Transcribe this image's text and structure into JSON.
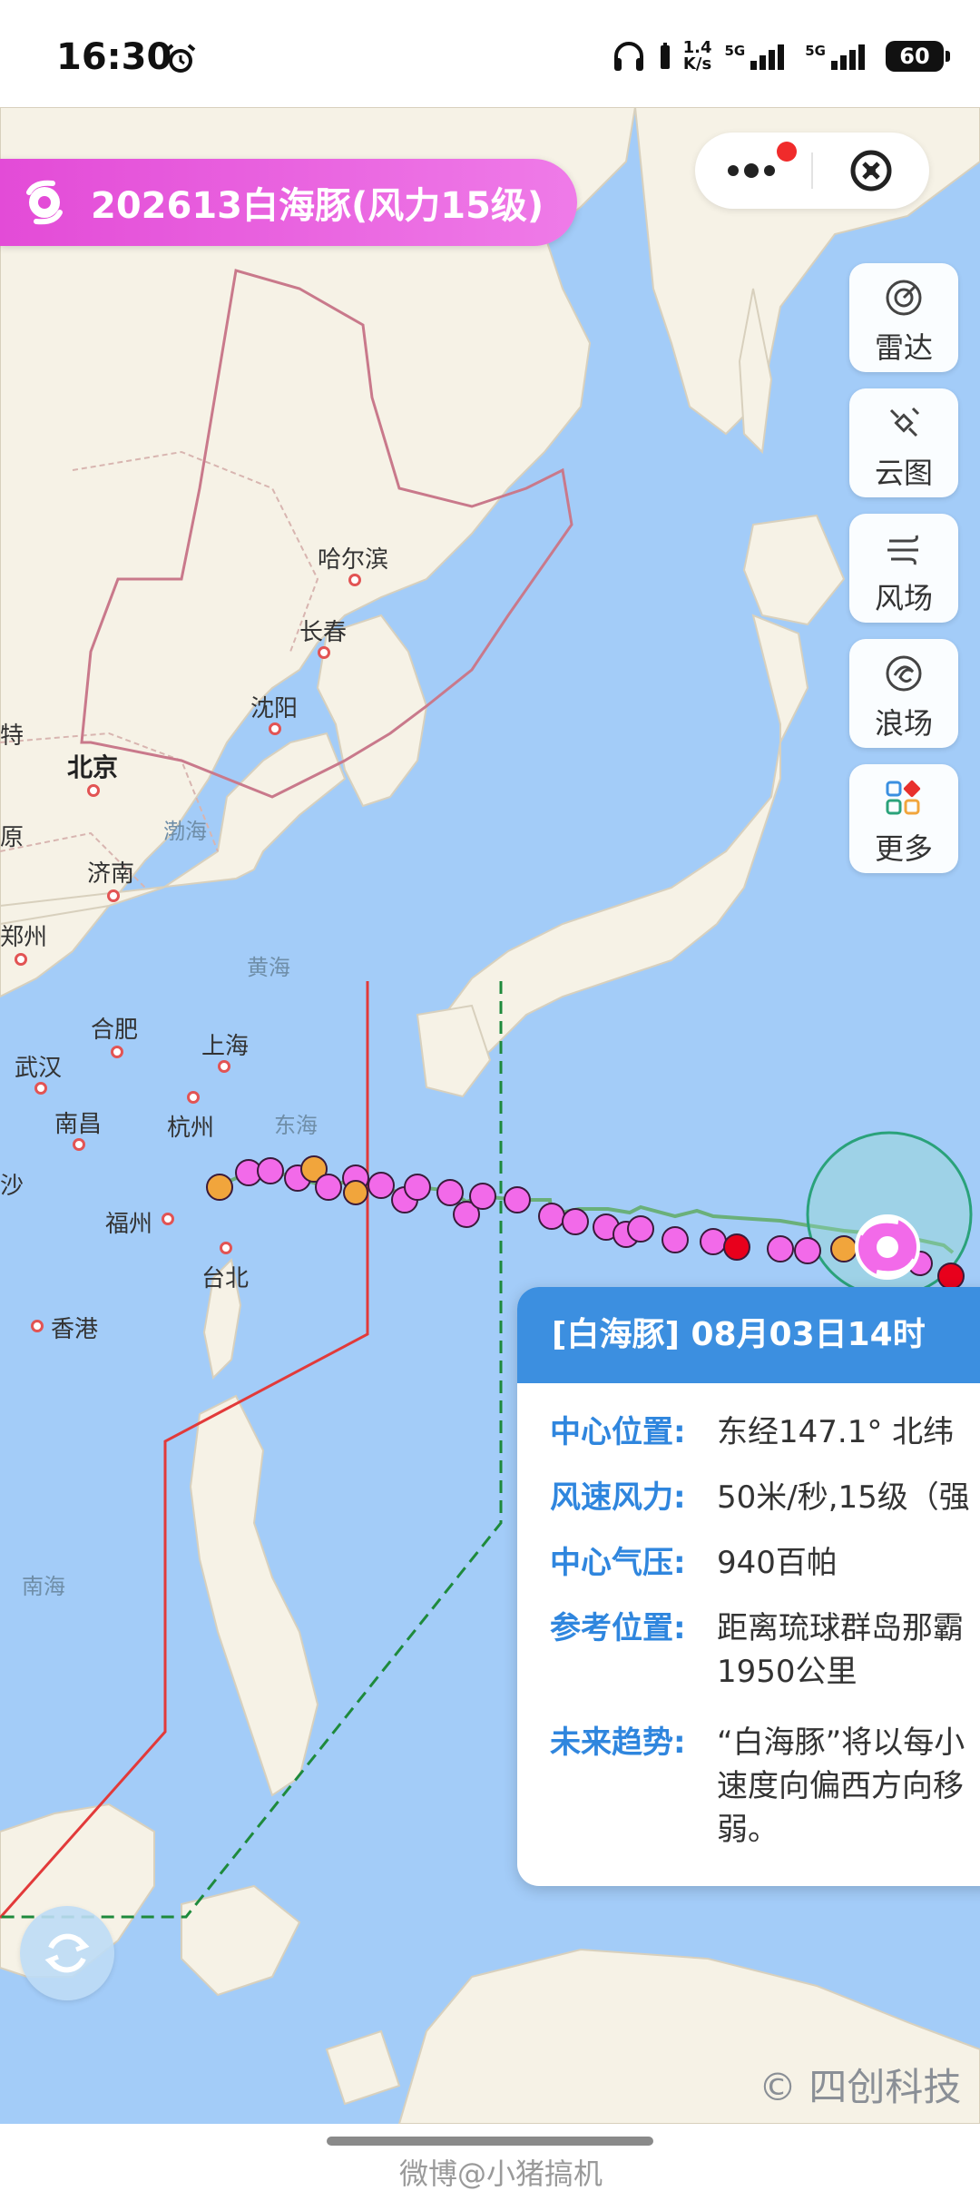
{
  "status_bar": {
    "time": "16:30",
    "net_speed_top": "1.4",
    "net_speed_unit": "K/s",
    "sim1": "5G",
    "sim2": "5G",
    "battery": "60"
  },
  "storm": {
    "banner_title": "202613白海豚(风力15级)"
  },
  "tools": [
    {
      "label": "雷达",
      "icon": "radar-icon"
    },
    {
      "label": "云图",
      "icon": "satellite-icon"
    },
    {
      "label": "风场",
      "icon": "wind-icon"
    },
    {
      "label": "浪场",
      "icon": "wave-icon"
    },
    {
      "label": "更多",
      "icon": "more-grid-icon"
    }
  ],
  "map": {
    "cities": [
      "哈尔滨",
      "长春",
      "沈阳",
      "北京",
      "济南",
      "郑州",
      "合肥",
      "上海",
      "武汉",
      "南昌",
      "杭州",
      "福州",
      "台北",
      "香港",
      "特",
      "原",
      "沙"
    ],
    "seas": [
      "渤海",
      "黄海",
      "东海",
      "南海"
    ],
    "colors": {
      "sea": "#a3ccf8",
      "land": "#f6f2e6",
      "track_forecast": "#f26ae9",
      "track_strong": "#f1a53c",
      "track_super": "#e8001c",
      "warn_24h": "#e23a3a",
      "warn_48h": "#1e8a3c"
    }
  },
  "info_card": {
    "header": "[白海豚] 08月03日14时",
    "rows": [
      {
        "key": "中心位置:",
        "value": [
          "东经147.1°   北纬"
        ]
      },
      {
        "key": "风速风力:",
        "value": [
          "50米/秒,15级（强"
        ]
      },
      {
        "key": "中心气压:",
        "value": [
          "940百帕"
        ]
      },
      {
        "key": "参考位置:",
        "value": [
          "距离琉球群岛那霸",
          "1950公里"
        ]
      },
      {
        "key": "未来趋势:",
        "value": [
          "“白海豚”将以每小",
          "速度向偏西方向移",
          "弱。"
        ]
      }
    ]
  },
  "copyright": "© 四创科技",
  "watermark": "微博@小猪搞机"
}
